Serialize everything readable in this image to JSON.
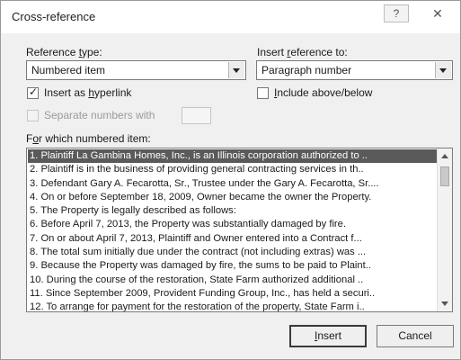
{
  "dialog": {
    "title": "Cross-reference",
    "help_label": "?",
    "close_label": "✕"
  },
  "reference_type": {
    "label_pre": "Reference ",
    "label_key": "t",
    "label_post": "ype:",
    "value": "Numbered item"
  },
  "insert_reference_to": {
    "label_pre": "Insert ",
    "label_key": "r",
    "label_post": "eference to:",
    "value": "Paragraph number"
  },
  "insert_as_hyperlink": {
    "checked": true,
    "check_glyph": "✓",
    "label_pre": "Insert as ",
    "label_key": "h",
    "label_post": "yperlink"
  },
  "include_above_below": {
    "checked": false,
    "label_pre": "",
    "label_key": "I",
    "label_post": "nclude above/below"
  },
  "separate_numbers": {
    "enabled": false,
    "label_pre": "Separate numbers with",
    "label_key": "",
    "label_post": ""
  },
  "for_which": {
    "label_pre": "F",
    "label_key": "o",
    "label_post": "r which numbered item:"
  },
  "items": [
    "1. Plaintiff La Gambina Homes, Inc., is an Illinois corporation authorized to ..",
    "2. Plaintiff is in the business of providing general contracting services in th..",
    "3. Defendant Gary A. Fecarotta, Sr., Trustee under the Gary A. Fecarotta, Sr....",
    "4. On or before September 18, 2009, Owner became the owner the Property.",
    "5. The Property is legally described as follows:",
    "6. Before April 7, 2013, the Property was substantially damaged by fire.",
    "7. On or about April 7, 2013, Plaintiff and Owner entered into a Contract f...",
    "8. The total sum initially due under the contract (not including extras) was ...",
    "9. Because the Property was damaged by fire, the sums to be paid to Plaint..",
    "10. During the course of the restoration, State Farm authorized additional ..",
    "11. Since September 2009, Provident Funding Group, Inc., has held a securi..",
    "12. To arrange for payment for the restoration of the property, State Farm i.."
  ],
  "selected_index": 0,
  "buttons": {
    "insert_pre": "",
    "insert_key": "I",
    "insert_post": "nsert",
    "cancel": "Cancel"
  }
}
